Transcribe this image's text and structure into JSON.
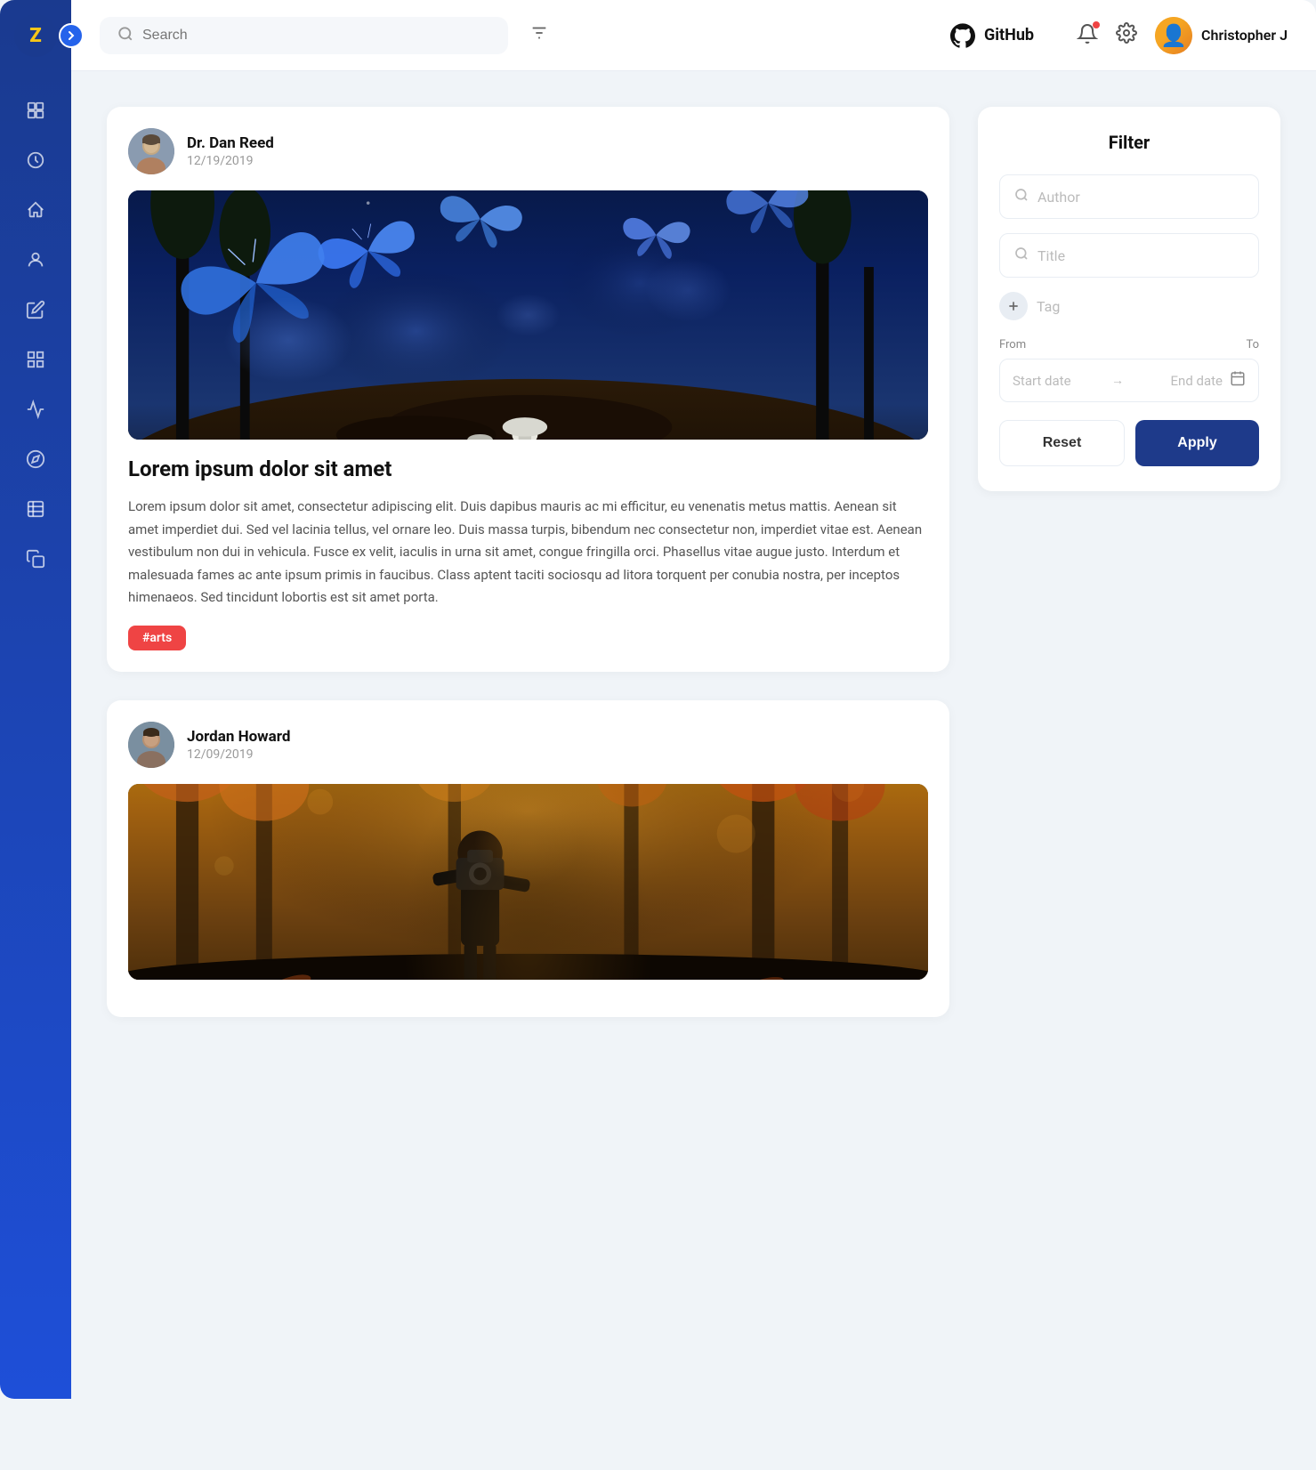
{
  "app": {
    "logo_letter": "Z",
    "expand_label": "›"
  },
  "header": {
    "search_placeholder": "Search",
    "github_label": "GitHub",
    "user_name": "Christopher J"
  },
  "sidebar": {
    "items": [
      {
        "name": "nft-icon",
        "symbol": "◈",
        "active": false
      },
      {
        "name": "dashboard-icon",
        "symbol": "⊙",
        "active": false
      },
      {
        "name": "home-icon",
        "symbol": "⌂",
        "active": false
      },
      {
        "name": "user-icon",
        "symbol": "♟",
        "active": false
      },
      {
        "name": "edit-icon",
        "symbol": "✎",
        "active": false
      },
      {
        "name": "grid-icon",
        "symbol": "⊞",
        "active": false
      },
      {
        "name": "chart-icon",
        "symbol": "⌇",
        "active": false
      },
      {
        "name": "compass-icon",
        "symbol": "◎",
        "active": false
      },
      {
        "name": "table-icon",
        "symbol": "▤",
        "active": false
      },
      {
        "name": "copy-icon",
        "symbol": "⧉",
        "active": false
      }
    ]
  },
  "posts": [
    {
      "id": "post-1",
      "author_name": "Dr. Dan Reed",
      "author_date": "12/19/2019",
      "image_type": "butterfly",
      "title": "Lorem ipsum dolor sit amet",
      "body": "Lorem ipsum dolor sit amet, consectetur adipiscing elit. Duis dapibus mauris ac mi efficitur, eu venenatis metus mattis. Aenean sit amet imperdiet dui. Sed vel lacinia tellus, vel ornare leo. Duis massa turpis, bibendum nec consectetur non, imperdiet vitae est. Aenean vestibulum non dui in vehicula. Fusce ex velit, iaculis in urna sit amet, congue fringilla orci. Phasellus vitae augue justo. Interdum et malesuada fames ac ante ipsum primis in faucibus. Class aptent taciti sociosqu ad litora torquent per conubia nostra, per inceptos himenaeos. Sed tincidunt lobortis est sit amet porta.",
      "tag": "#arts",
      "tag_color": "arts"
    },
    {
      "id": "post-2",
      "author_name": "Jordan Howard",
      "author_date": "12/09/2019",
      "image_type": "photographer",
      "title": "",
      "body": "",
      "tag": "",
      "tag_color": ""
    }
  ],
  "filter": {
    "title": "Filter",
    "author_placeholder": "Author",
    "title_placeholder": "Title",
    "tag_placeholder": "Tag",
    "from_label": "From",
    "to_label": "To",
    "start_date_placeholder": "Start date",
    "end_date_placeholder": "End date",
    "reset_label": "Reset",
    "apply_label": "Apply"
  }
}
